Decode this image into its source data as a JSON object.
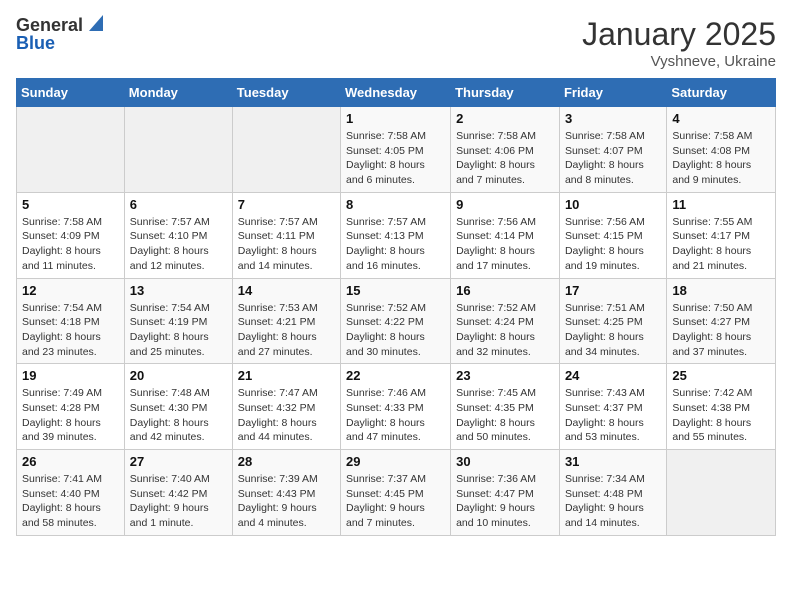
{
  "header": {
    "logo_general": "General",
    "logo_blue": "Blue",
    "title": "January 2025",
    "location": "Vyshneve, Ukraine"
  },
  "weekdays": [
    "Sunday",
    "Monday",
    "Tuesday",
    "Wednesday",
    "Thursday",
    "Friday",
    "Saturday"
  ],
  "weeks": [
    [
      {
        "day": "",
        "info": ""
      },
      {
        "day": "",
        "info": ""
      },
      {
        "day": "",
        "info": ""
      },
      {
        "day": "1",
        "info": "Sunrise: 7:58 AM\nSunset: 4:05 PM\nDaylight: 8 hours\nand 6 minutes."
      },
      {
        "day": "2",
        "info": "Sunrise: 7:58 AM\nSunset: 4:06 PM\nDaylight: 8 hours\nand 7 minutes."
      },
      {
        "day": "3",
        "info": "Sunrise: 7:58 AM\nSunset: 4:07 PM\nDaylight: 8 hours\nand 8 minutes."
      },
      {
        "day": "4",
        "info": "Sunrise: 7:58 AM\nSunset: 4:08 PM\nDaylight: 8 hours\nand 9 minutes."
      }
    ],
    [
      {
        "day": "5",
        "info": "Sunrise: 7:58 AM\nSunset: 4:09 PM\nDaylight: 8 hours\nand 11 minutes."
      },
      {
        "day": "6",
        "info": "Sunrise: 7:57 AM\nSunset: 4:10 PM\nDaylight: 8 hours\nand 12 minutes."
      },
      {
        "day": "7",
        "info": "Sunrise: 7:57 AM\nSunset: 4:11 PM\nDaylight: 8 hours\nand 14 minutes."
      },
      {
        "day": "8",
        "info": "Sunrise: 7:57 AM\nSunset: 4:13 PM\nDaylight: 8 hours\nand 16 minutes."
      },
      {
        "day": "9",
        "info": "Sunrise: 7:56 AM\nSunset: 4:14 PM\nDaylight: 8 hours\nand 17 minutes."
      },
      {
        "day": "10",
        "info": "Sunrise: 7:56 AM\nSunset: 4:15 PM\nDaylight: 8 hours\nand 19 minutes."
      },
      {
        "day": "11",
        "info": "Sunrise: 7:55 AM\nSunset: 4:17 PM\nDaylight: 8 hours\nand 21 minutes."
      }
    ],
    [
      {
        "day": "12",
        "info": "Sunrise: 7:54 AM\nSunset: 4:18 PM\nDaylight: 8 hours\nand 23 minutes."
      },
      {
        "day": "13",
        "info": "Sunrise: 7:54 AM\nSunset: 4:19 PM\nDaylight: 8 hours\nand 25 minutes."
      },
      {
        "day": "14",
        "info": "Sunrise: 7:53 AM\nSunset: 4:21 PM\nDaylight: 8 hours\nand 27 minutes."
      },
      {
        "day": "15",
        "info": "Sunrise: 7:52 AM\nSunset: 4:22 PM\nDaylight: 8 hours\nand 30 minutes."
      },
      {
        "day": "16",
        "info": "Sunrise: 7:52 AM\nSunset: 4:24 PM\nDaylight: 8 hours\nand 32 minutes."
      },
      {
        "day": "17",
        "info": "Sunrise: 7:51 AM\nSunset: 4:25 PM\nDaylight: 8 hours\nand 34 minutes."
      },
      {
        "day": "18",
        "info": "Sunrise: 7:50 AM\nSunset: 4:27 PM\nDaylight: 8 hours\nand 37 minutes."
      }
    ],
    [
      {
        "day": "19",
        "info": "Sunrise: 7:49 AM\nSunset: 4:28 PM\nDaylight: 8 hours\nand 39 minutes."
      },
      {
        "day": "20",
        "info": "Sunrise: 7:48 AM\nSunset: 4:30 PM\nDaylight: 8 hours\nand 42 minutes."
      },
      {
        "day": "21",
        "info": "Sunrise: 7:47 AM\nSunset: 4:32 PM\nDaylight: 8 hours\nand 44 minutes."
      },
      {
        "day": "22",
        "info": "Sunrise: 7:46 AM\nSunset: 4:33 PM\nDaylight: 8 hours\nand 47 minutes."
      },
      {
        "day": "23",
        "info": "Sunrise: 7:45 AM\nSunset: 4:35 PM\nDaylight: 8 hours\nand 50 minutes."
      },
      {
        "day": "24",
        "info": "Sunrise: 7:43 AM\nSunset: 4:37 PM\nDaylight: 8 hours\nand 53 minutes."
      },
      {
        "day": "25",
        "info": "Sunrise: 7:42 AM\nSunset: 4:38 PM\nDaylight: 8 hours\nand 55 minutes."
      }
    ],
    [
      {
        "day": "26",
        "info": "Sunrise: 7:41 AM\nSunset: 4:40 PM\nDaylight: 8 hours\nand 58 minutes."
      },
      {
        "day": "27",
        "info": "Sunrise: 7:40 AM\nSunset: 4:42 PM\nDaylight: 9 hours\nand 1 minute."
      },
      {
        "day": "28",
        "info": "Sunrise: 7:39 AM\nSunset: 4:43 PM\nDaylight: 9 hours\nand 4 minutes."
      },
      {
        "day": "29",
        "info": "Sunrise: 7:37 AM\nSunset: 4:45 PM\nDaylight: 9 hours\nand 7 minutes."
      },
      {
        "day": "30",
        "info": "Sunrise: 7:36 AM\nSunset: 4:47 PM\nDaylight: 9 hours\nand 10 minutes."
      },
      {
        "day": "31",
        "info": "Sunrise: 7:34 AM\nSunset: 4:48 PM\nDaylight: 9 hours\nand 14 minutes."
      },
      {
        "day": "",
        "info": ""
      }
    ]
  ]
}
